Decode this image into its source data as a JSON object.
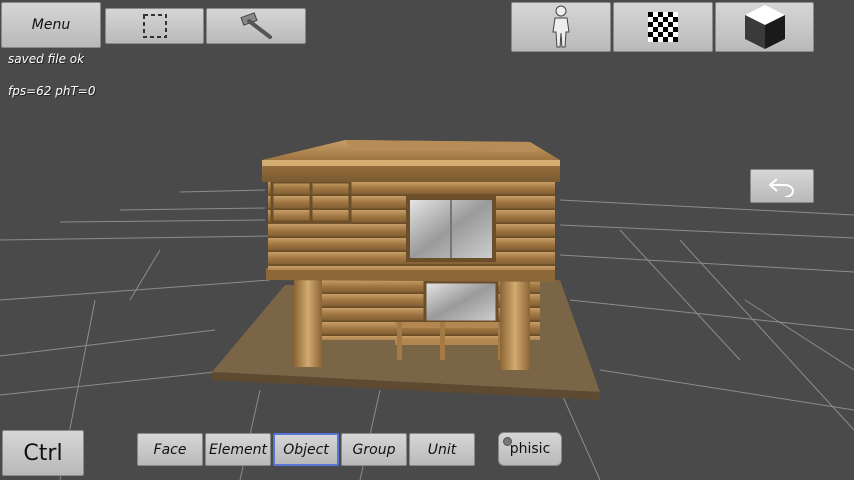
{
  "toolbar": {
    "menu_label": "Menu",
    "select_icon": "selection-rect-icon",
    "tool_icon": "hammer-icon"
  },
  "right_toolbar": {
    "icons": [
      "human-figure-icon",
      "checkerboard-icon",
      "cube-icon"
    ]
  },
  "status": {
    "message": "saved file ok",
    "stats": "fps=62 phT=0"
  },
  "undo_icon": "undo-arrow-icon",
  "modes": {
    "items": [
      "Face",
      "Element",
      "Object",
      "Group",
      "Unit"
    ],
    "selected": "Object"
  },
  "ctrl_label": "Ctrl",
  "physic_label": "phisic",
  "colors": {
    "background": "#4a4a4a",
    "grid": "#8c8c8c",
    "wood": "#a47a45",
    "selected_border": "#5a73d6"
  }
}
